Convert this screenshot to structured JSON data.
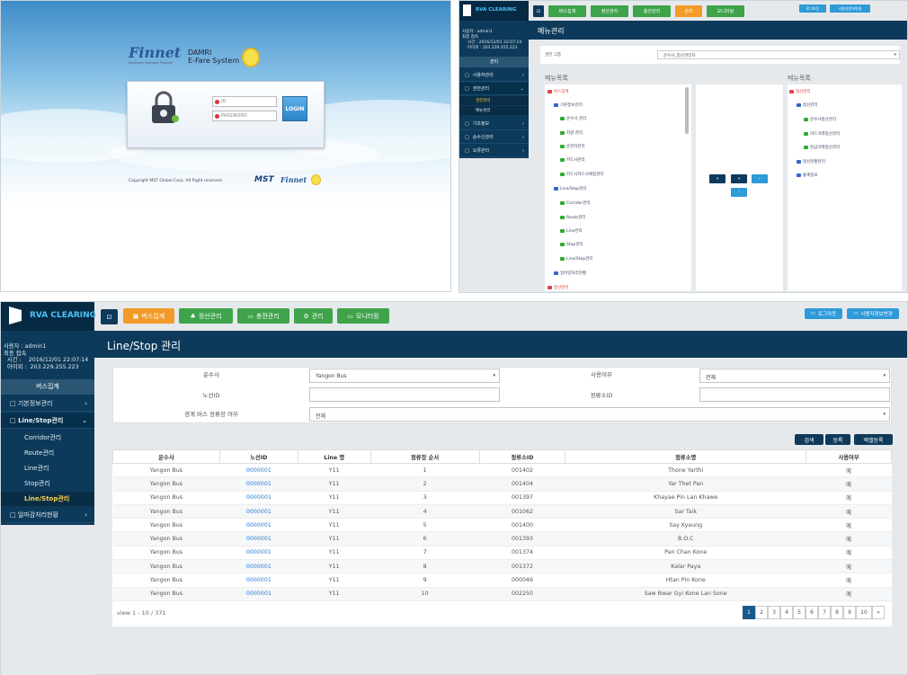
{
  "login": {
    "brand": "Finnet",
    "brand_sub": "Electronic Payment Provider",
    "partner1": "DAMRI",
    "partner2": "E-Fare System",
    "id_placeholder": "ID",
    "pw_placeholder": "PASSWORD",
    "login_btn": "LOGIN",
    "copyright": "Copyright MST Global Corp. All Right reserved.",
    "mst": "MST"
  },
  "menu_panel": {
    "logo": "RVA CLEARING",
    "nav": [
      "버스집계",
      "정산관리",
      "충전관리",
      "관리",
      "모니터링"
    ],
    "top_right": [
      "로그아웃",
      "사용자정보변경"
    ],
    "user_label": "사용자 : admin1",
    "access_label": "최종 접속",
    "time_label": "시간 :",
    "time": "2016/12/01 22:07:14",
    "ip_label": "아이피 :",
    "ip": "203.229.255.223",
    "current": "관리",
    "sidebar": [
      "사용자관리",
      "권한관리",
      "권한관리",
      "메뉴관리",
      "기초정보",
      "승수신관리",
      "오류관리"
    ],
    "title": "메뉴관리",
    "group_label": "권한 그룹",
    "group_value": "운수사_정산관리자",
    "left_header": "메뉴목록",
    "right_header": "메뉴목록",
    "left_tree": [
      "버스집계",
      "기본정보관리",
      "운수사 관리",
      "차량 관리",
      "운전자관리",
      "카드사관리",
      "카드사카드사매칭관리",
      "Line/Stop관리",
      "Corridor관리",
      "Route관리",
      "Line관리",
      "Stop관리",
      "Line/Stop관리",
      "일마감처리현황",
      "정산관리"
    ],
    "right_tree": [
      "정산관리",
      "정산관리",
      "운수사정산관리",
      "카드거래정산관리",
      "현금거래정산관리",
      "정산현황관리",
      "통계정보"
    ]
  },
  "line_stop": {
    "logo": "RVA CLEARING",
    "nav": [
      "버스집계",
      "정산관리",
      "충전관리",
      "관리",
      "모니터링"
    ],
    "top_right": [
      "로그아웃",
      "사용자정보변경"
    ],
    "user_label": "사용자 : admin1",
    "access_label": "최종 접속",
    "time_label": "시간 :",
    "time": "2016/12/01 22:07:14",
    "ip_label": "아이피 :",
    "ip": "203.229.255.223",
    "current": "버스집계",
    "sidebar": [
      "기본정보관리",
      "Line/Stop관리",
      "Corridor관리",
      "Route관리",
      "Line관리",
      "Stop관리",
      "Line/Stop관리",
      "일마감처리현황"
    ],
    "title": "Line/Stop 관리",
    "filters": {
      "operator_label": "운수사",
      "operator_value": "Yangon Bus",
      "use_label": "사용여부",
      "use_value": "전체",
      "route_label": "노선ID",
      "route_value": "",
      "stop_label": "정류소ID",
      "stop_value": "",
      "boundary_label": "경계 버스 정류장 여부",
      "boundary_value": "전체"
    },
    "actions": [
      "검색",
      "등록",
      "엑셀등록"
    ],
    "columns": [
      "운수사",
      "노선ID",
      "Line 명",
      "정류장 순서",
      "정류소ID",
      "정류소명",
      "사용여부"
    ],
    "rows": [
      [
        "Yangon Bus",
        "0000001",
        "Y11",
        "1",
        "001402",
        "Thone Yarthi",
        "예"
      ],
      [
        "Yangon Bus",
        "0000001",
        "Y11",
        "2",
        "001404",
        "Yar Thet Pan",
        "예"
      ],
      [
        "Yangon Bus",
        "0000001",
        "Y11",
        "3",
        "001397",
        "Khayae Pin Lan Khawe",
        "예"
      ],
      [
        "Yangon Bus",
        "0000001",
        "Y11",
        "4",
        "001062",
        "Sar Taik",
        "예"
      ],
      [
        "Yangon Bus",
        "0000001",
        "Y11",
        "5",
        "001400",
        "Say Kyaung",
        "예"
      ],
      [
        "Yangon Bus",
        "0000001",
        "Y11",
        "6",
        "001393",
        "B.O.C",
        "예"
      ],
      [
        "Yangon Bus",
        "0000001",
        "Y11",
        "7",
        "001374",
        "Pan Chan Kone",
        "예"
      ],
      [
        "Yangon Bus",
        "0000001",
        "Y11",
        "8",
        "001372",
        "Kalar Paya",
        "예"
      ],
      [
        "Yangon Bus",
        "0000001",
        "Y11",
        "9",
        "000046",
        "Htan Pin Kone",
        "예"
      ],
      [
        "Yangon Bus",
        "0000001",
        "Y11",
        "10",
        "002250",
        "Saw Bwar Gyi Kone Lan Sone",
        "예"
      ]
    ],
    "view_text": "view 1 - 10 / 371",
    "pages": [
      "1",
      "2",
      "3",
      "4",
      "5",
      "6",
      "7",
      "8",
      "9",
      "10",
      "»"
    ]
  }
}
